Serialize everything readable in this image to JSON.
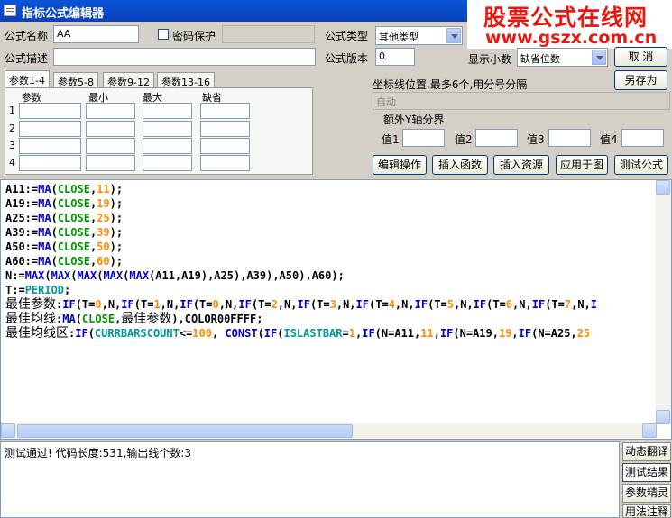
{
  "window": {
    "title": "指标公式编辑器"
  },
  "watermark": {
    "line1": "股票公式在线网",
    "line2": "www.gszx.com.cn"
  },
  "form": {
    "name_label": "公式名称",
    "name_value": "AA",
    "password_label": "密码保护",
    "type_label": "公式类型",
    "type_value": "其他类型",
    "desc_label": "公式描述",
    "version_label": "公式版本",
    "version_value": "0",
    "decimal_label": "显示小数",
    "decimal_value": "缺省位数"
  },
  "buttons": {
    "cancel": "取  消",
    "save_as": "另存为",
    "edit": "编辑操作",
    "insert_func": "插入函数",
    "insert_res": "插入资源",
    "apply": "应用于图",
    "test": "测试公式"
  },
  "params": {
    "tabs": [
      "参数1-4",
      "参数5-8",
      "参数9-12",
      "参数13-16"
    ],
    "headers": [
      "参数",
      "最小",
      "最大",
      "缺省"
    ],
    "rows": [
      "1",
      "2",
      "3",
      "4"
    ]
  },
  "coords": {
    "label": "坐标线位置,最多6个,用分号分隔",
    "placeholder": "自动",
    "group_label": "额外Y轴分界",
    "values": [
      "值1",
      "值2",
      "值3",
      "值4"
    ]
  },
  "status": {
    "text": "测试通过! 代码长度:531,输出线个数:3"
  },
  "side": {
    "dynamic": "动态翻译",
    "result": "测试结果",
    "param_wizard": "参数精灵",
    "usage": "用法注释"
  },
  "icons": {
    "window": "window-icon",
    "checkbox": "checkbox-icon",
    "dropdown": "chevron-down-icon"
  }
}
